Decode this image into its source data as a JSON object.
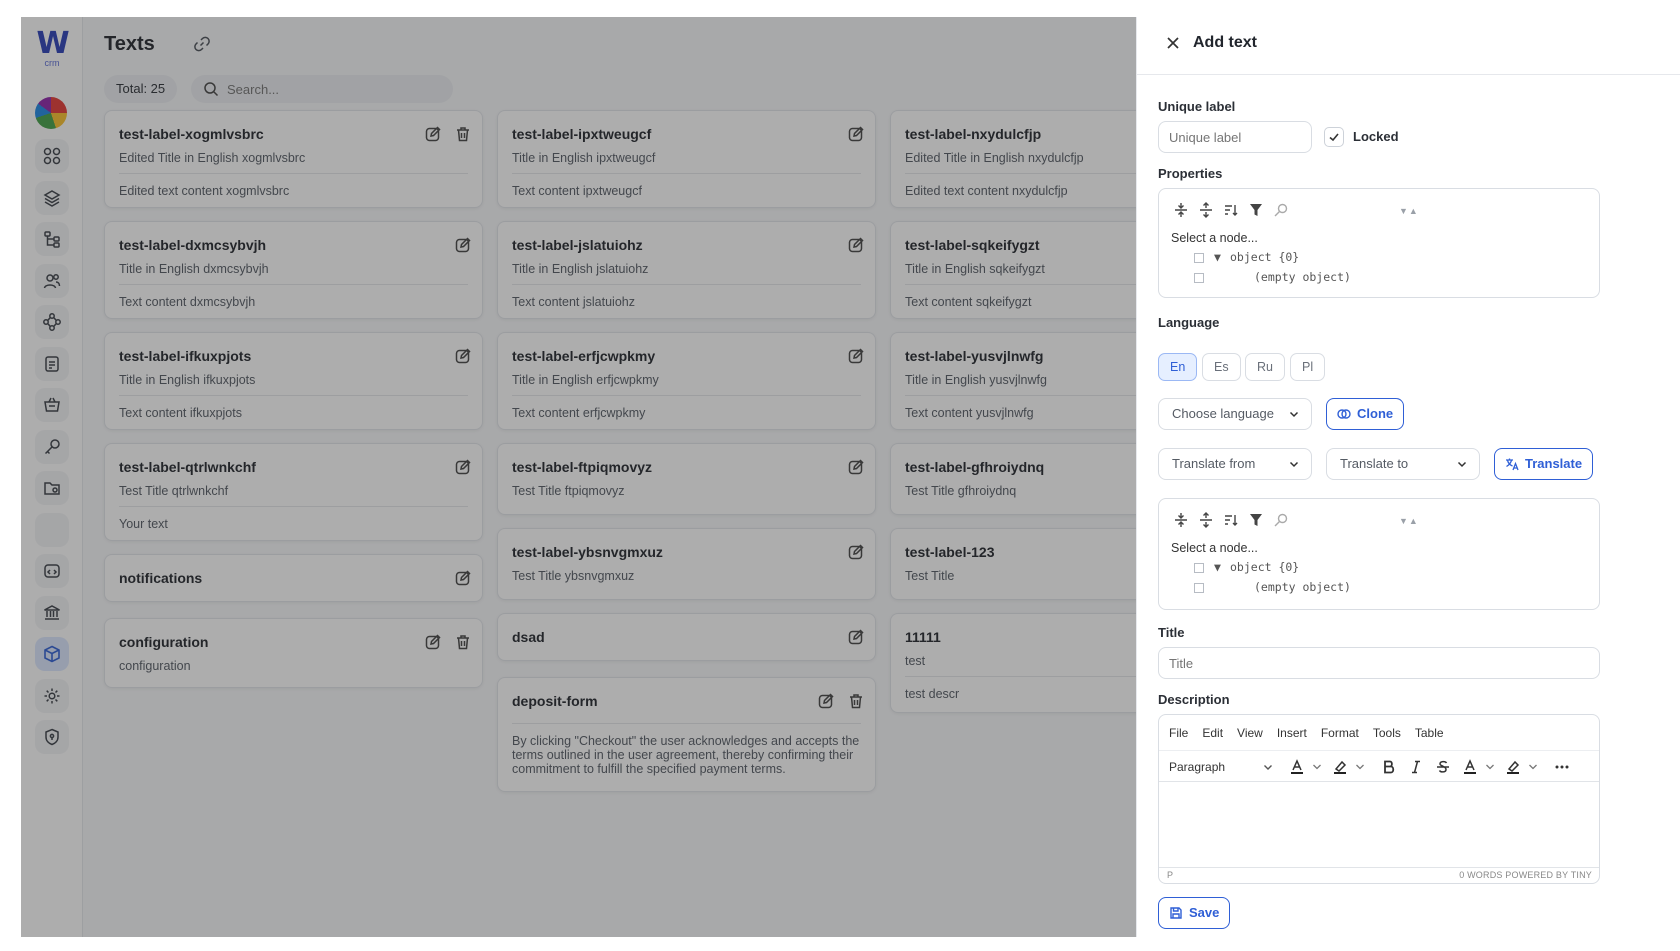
{
  "app": {
    "logo_letter": "W",
    "logo_sub": "crm"
  },
  "page": {
    "title": "Texts",
    "total": "Total: 25",
    "search_placeholder": "Search..."
  },
  "cards": [
    {
      "label": "test-label-xogmlvsbrc",
      "title": "Edited Title in English xogmlvsbrc",
      "content": "Edited text content xogmlvsbrc"
    },
    {
      "label": "test-label-ipxtweugcf",
      "title": "Title in English ipxtweugcf",
      "content": "Text content ipxtweugcf"
    },
    {
      "label": "test-label-nxydulcfjp",
      "title": "Edited Title in English nxydulcfjp",
      "content": "Edited text content nxydulcfjp"
    },
    {
      "label": "test-label-dxmcsybvjh",
      "title": "Title in English dxmcsybvjh",
      "content": "Text content dxmcsybvjh"
    },
    {
      "label": "test-label-jslatuiohz",
      "title": "Title in English jslatuiohz",
      "content": "Text content jslatuiohz"
    },
    {
      "label": "test-label-sqkeifygzt",
      "title": "Title in English sqkeifygzt",
      "content": "Text content sqkeifygzt"
    },
    {
      "label": "test-label-ifkuxpjots",
      "title": "Title in English ifkuxpjots",
      "content": "Text content ifkuxpjots"
    },
    {
      "label": "test-label-erfjcwpkmy",
      "title": "Title in English erfjcwpkmy",
      "content": "Text content erfjcwpkmy"
    },
    {
      "label": "test-label-yusvjlnwfg",
      "title": "Title in English yusvjlnwfg",
      "content": "Text content yusvjlnwfg"
    },
    {
      "label": "test-label-qtrlwnkchf",
      "title": "Test Title qtrlwnkchf",
      "content": "Your text"
    },
    {
      "label": "test-label-ftpiqmovyz",
      "title": "Test Title ftpiqmovyz",
      "content": ""
    },
    {
      "label": "test-label-gfhroiydnq",
      "title": "Test Title gfhroiydnq",
      "content": ""
    },
    {
      "label": "notifications",
      "title": "",
      "content": ""
    },
    {
      "label": "test-label-ybsnvgmxuz",
      "title": "Test Title ybsnvgmxuz",
      "content": ""
    },
    {
      "label": "test-label-123",
      "title": "Test Title",
      "content": ""
    },
    {
      "label": "configuration",
      "title": "configuration",
      "content": ""
    },
    {
      "label": "dsad",
      "title": "",
      "content": ""
    },
    {
      "label": "11111",
      "title": "test",
      "content": "test descr"
    },
    {
      "label": "deposit-form",
      "title": "",
      "content": "By clicking \"Checkout\" the user acknowledges and accepts the terms outlined in the user agreement, thereby confirming their commitment to fulfill the specified payment terms."
    }
  ],
  "drawer": {
    "title": "Add text",
    "unique_label": {
      "label": "Unique label",
      "placeholder": "Unique label",
      "locked_label": "Locked"
    },
    "properties": {
      "label": "Properties",
      "select_node": "Select a node...",
      "root": "object {0}",
      "empty": "(empty object)"
    },
    "language": {
      "label": "Language",
      "tabs": [
        "En",
        "Es",
        "Ru",
        "Pl"
      ],
      "selected": "En",
      "choose": "Choose language",
      "clone": "Clone",
      "translate_from": "Translate from",
      "translate_to": "Translate to",
      "translate": "Translate"
    },
    "values_tree": {
      "select_node": "Select a node...",
      "root": "object {0}",
      "empty": "(empty object)"
    },
    "title_field": {
      "label": "Title",
      "placeholder": "Title"
    },
    "description": {
      "label": "Description",
      "menu": [
        "File",
        "Edit",
        "View",
        "Insert",
        "Format",
        "Tools",
        "Table"
      ],
      "block_format": "Paragraph",
      "status_path": "P",
      "status_right": "0 WORDS  POWERED BY TINY"
    },
    "save": "Save"
  },
  "colors": {
    "accent": "#2f5fd6",
    "overlay": "#282828"
  }
}
